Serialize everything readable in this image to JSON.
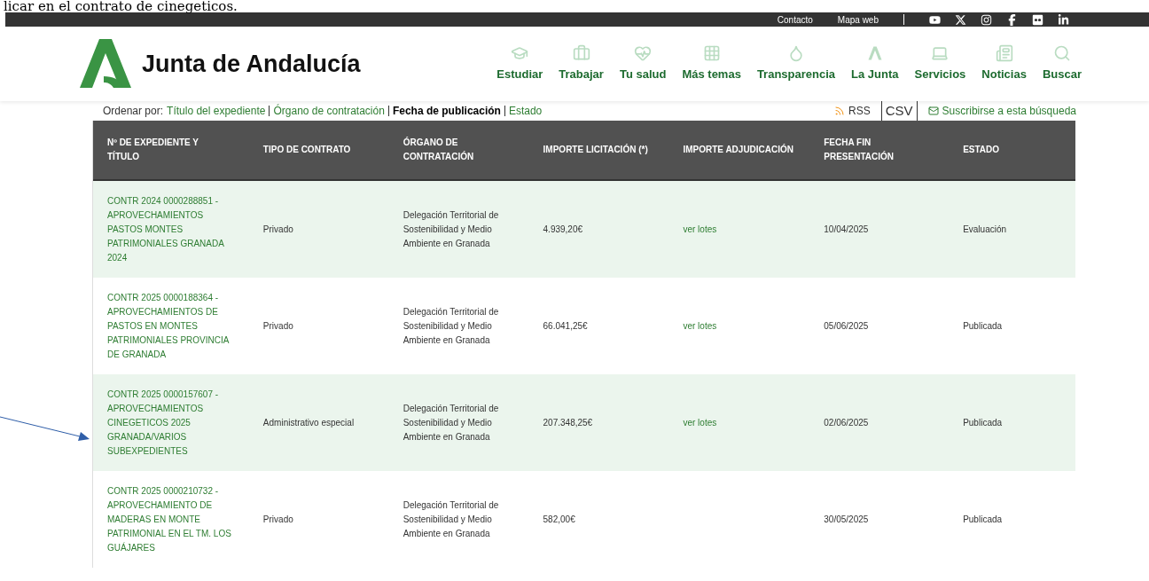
{
  "annotation_text": "licar en el contrato de cinegeticos.",
  "top_bar": {
    "links": [
      "Contacto",
      "Mapa web"
    ]
  },
  "header": {
    "brand": "Junta de Andalucía",
    "nav": [
      {
        "label": "Estudiar"
      },
      {
        "label": "Trabajar"
      },
      {
        "label": "Tu salud"
      },
      {
        "label": "Más temas"
      },
      {
        "label": "Transparencia"
      },
      {
        "label": "La Junta"
      },
      {
        "label": "Servicios"
      },
      {
        "label": "Noticias"
      },
      {
        "label": "Buscar"
      }
    ]
  },
  "sort_bar": {
    "label": "Ordenar por:",
    "options": [
      {
        "label": "Título del expediente",
        "selected": false
      },
      {
        "label": "Órgano de contratación",
        "selected": false
      },
      {
        "label": "Fecha de publicación",
        "selected": true
      },
      {
        "label": "Estado",
        "selected": false
      }
    ],
    "rss": "RSS",
    "csv": "CSV",
    "subscribe": "Suscribirse a esta búsqueda"
  },
  "table": {
    "columns": [
      "Nº DE EXPEDIENTE Y TÍTULO",
      "TIPO DE CONTRATO",
      "ÓRGANO DE CONTRATACIÓN",
      "IMPORTE LICITACIÓN (*)",
      "IMPORTE ADJUDICACIÓN",
      "FECHA FIN PRESENTACIÓN",
      "ESTADO"
    ],
    "rows": [
      {
        "title": "CONTR 2024 0000288851 - APROVECHAMIENTOS PASTOS MONTES PATRIMONIALES GRANADA 2024",
        "type": "Privado",
        "organ": "Delegación Territorial de Sostenibilidad y Medio Ambiente en Granada",
        "amount": "4.939,20€",
        "award": "ver lotes",
        "date": "10/04/2025",
        "status": "Evaluación"
      },
      {
        "title": "CONTR 2025 0000188364 - APROVECHAMIENTOS DE PASTOS EN MONTES PATRIMONIALES PROVINCIA DE GRANADA",
        "type": "Privado",
        "organ": "Delegación Territorial de Sostenibilidad y Medio Ambiente en Granada",
        "amount": "66.041,25€",
        "award": "ver lotes",
        "date": "05/06/2025",
        "status": "Publicada"
      },
      {
        "title": "CONTR 2025 0000157607 - APROVECHAMIENTOS CINEGETICOS 2025 GRANADA/VARIOS SUBEXPEDIENTES",
        "type": "Administrativo especial",
        "organ": "Delegación Territorial de Sostenibilidad y Medio Ambiente en Granada",
        "amount": "207.348,25€",
        "award": "ver lotes",
        "date": "02/06/2025",
        "status": "Publicada"
      },
      {
        "title": "CONTR 2025 0000210732 - APROVECHAMIENTO DE MADERAS EN MONTE PATRIMONIAL EN EL TM. LOS GUÁJARES",
        "type": "Privado",
        "organ": "Delegación Territorial de Sostenibilidad y Medio Ambiente en Granada",
        "amount": "582,00€",
        "date": "30/05/2025",
        "status": "Publicada"
      }
    ]
  }
}
